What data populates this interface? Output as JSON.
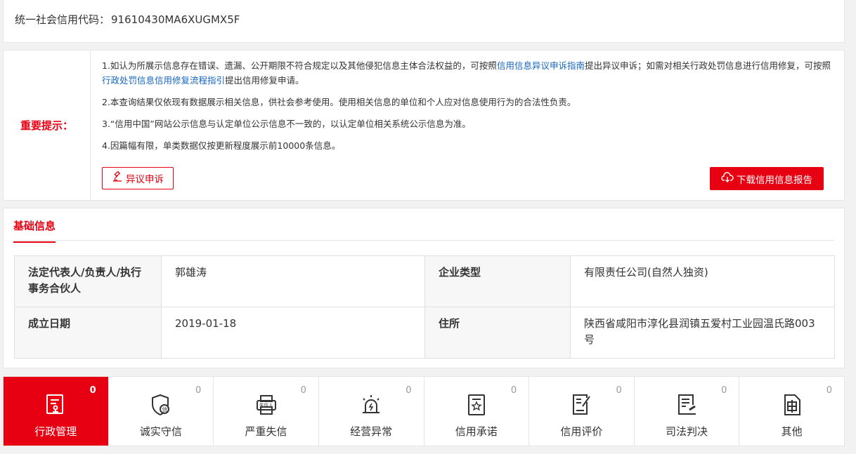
{
  "credit_code": {
    "label": "统一社会信用代码：",
    "value": "91610430MA6XUGMX5F"
  },
  "notice": {
    "label": "重要提示：",
    "p1_a": "1.如认为所展示信息存在错误、遗漏、公开期限不符合规定以及其他侵犯信息主体合法权益的，可按照",
    "p1_link1": "信用信息异议申诉指南",
    "p1_b": "提出异议申诉；如需对相关行政处罚信息进行信用修复，可按照",
    "p1_link2": "行政处罚信息信用修复流程指引",
    "p1_c": "提出信用修复申请。",
    "p2": "2.本查询结果仅依现有数据展示相关信息，供社会参考使用。使用相关信息的单位和个人应对信息使用行为的合法性负责。",
    "p3": "3.“信用中国”网站公示信息与认定单位公示信息不一致的，以认定单位相关系统公示信息为准。",
    "p4": "4.因篇幅有限，单类数据仅按更新程度展示前10000条信息。",
    "dispute_button": "异议申诉",
    "download_button": "下载信用信息报告"
  },
  "basic_info": {
    "tab_label": "基础信息",
    "rows": [
      {
        "k1": "法定代表人/负责人/执行事务合伙人",
        "v1": "郭雄涛",
        "k2": "企业类型",
        "v2": "有限责任公司(自然人独资)"
      },
      {
        "k1": "成立日期",
        "v1": "2019-01-18",
        "k2": "住所",
        "v2": "陕西省咸阳市淳化县润镇五爱村工业园温氏路003号"
      }
    ]
  },
  "categories": [
    {
      "label": "行政管理",
      "count": "0",
      "icon": "admin-doc-icon"
    },
    {
      "label": "诚实守信",
      "count": "0",
      "icon": "shield-badge-icon"
    },
    {
      "label": "严重失信",
      "count": "0",
      "icon": "printer-dishonest-icon"
    },
    {
      "label": "经营异常",
      "count": "0",
      "icon": "alarm-light-icon"
    },
    {
      "label": "信用承诺",
      "count": "0",
      "icon": "star-document-icon"
    },
    {
      "label": "信用评价",
      "count": "0",
      "icon": "checklist-pen-icon"
    },
    {
      "label": "司法判决",
      "count": "0",
      "icon": "legal-doc-icon"
    },
    {
      "label": "其他",
      "count": "0",
      "icon": "other-doc-icon"
    }
  ],
  "colors": {
    "accent": "#e60012",
    "link": "#1565c0"
  }
}
